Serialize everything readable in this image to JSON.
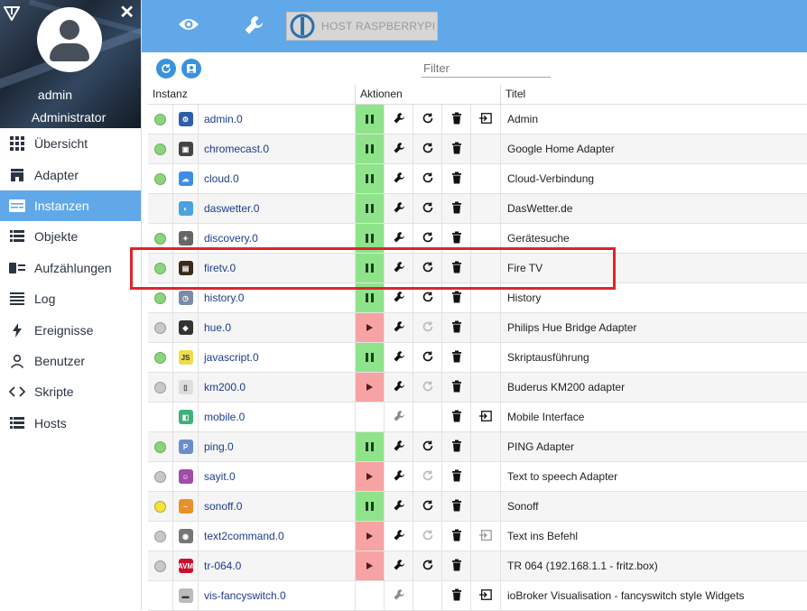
{
  "sidebar": {
    "user_name": "admin",
    "user_role": "Administrator",
    "items": [
      {
        "label": "Übersicht",
        "icon": "grid-icon",
        "active": false
      },
      {
        "label": "Adapter",
        "icon": "store-icon",
        "active": false
      },
      {
        "label": "Instanzen",
        "icon": "instances-icon",
        "active": true
      },
      {
        "label": "Objekte",
        "icon": "list-icon",
        "active": false
      },
      {
        "label": "Aufzählungen",
        "icon": "enum-icon",
        "active": false
      },
      {
        "label": "Log",
        "icon": "log-icon",
        "active": false
      },
      {
        "label": "Ereignisse",
        "icon": "lightning-icon",
        "active": false
      },
      {
        "label": "Benutzer",
        "icon": "user-icon",
        "active": false
      },
      {
        "label": "Skripte",
        "icon": "code-icon",
        "active": false
      },
      {
        "label": "Hosts",
        "icon": "hosts-icon",
        "active": false
      }
    ]
  },
  "topbar": {
    "host_label": "HOST RASPBERRYPI"
  },
  "toolbar": {
    "filter_placeholder": "Filter"
  },
  "table": {
    "headers": {
      "instance": "Instanz",
      "actions": "Aktionen",
      "title": "Titel"
    },
    "rows": [
      {
        "name": "admin.0",
        "title": "Admin",
        "status": "green",
        "run": "pause",
        "restart": true,
        "delete": true,
        "open": true,
        "icon_color": "#2d5ea8",
        "icon_text": "⚙"
      },
      {
        "name": "chromecast.0",
        "title": "Google Home Adapter",
        "status": "green",
        "run": "pause",
        "restart": true,
        "delete": true,
        "open": false,
        "icon_color": "#444444",
        "icon_text": "▣"
      },
      {
        "name": "cloud.0",
        "title": "Cloud-Verbindung",
        "status": "green",
        "run": "pause",
        "restart": true,
        "delete": true,
        "open": false,
        "icon_color": "#3d8ee6",
        "icon_text": "☁"
      },
      {
        "name": "daswetter.0",
        "title": "DasWetter.de",
        "status": "none",
        "run": "pause",
        "restart": true,
        "delete": true,
        "open": false,
        "icon_color": "#4aa3df",
        "icon_text": "◐"
      },
      {
        "name": "discovery.0",
        "title": "Gerätesuche",
        "status": "green",
        "run": "pause",
        "restart": true,
        "delete": true,
        "open": false,
        "icon_color": "#666666",
        "icon_text": "✦"
      },
      {
        "name": "firetv.0",
        "title": "Fire TV",
        "status": "green",
        "run": "pause",
        "restart": true,
        "delete": true,
        "open": false,
        "icon_color": "#3b2a1a",
        "icon_text": "▤"
      },
      {
        "name": "history.0",
        "title": "History",
        "status": "green",
        "run": "pause",
        "restart": true,
        "delete": true,
        "open": false,
        "icon_color": "#7a8aa8",
        "icon_text": "◷"
      },
      {
        "name": "hue.0",
        "title": "Philips Hue Bridge Adapter",
        "status": "grey",
        "run": "play",
        "restart": false,
        "delete": true,
        "open": false,
        "icon_color": "#333333",
        "icon_text": "◆"
      },
      {
        "name": "javascript.0",
        "title": "Skriptausführung",
        "status": "green",
        "run": "pause",
        "restart": true,
        "delete": true,
        "open": false,
        "icon_color": "#f0db4f",
        "icon_text": "JS"
      },
      {
        "name": "km200.0",
        "title": "Buderus KM200 adapter",
        "status": "grey",
        "run": "play",
        "restart": false,
        "delete": true,
        "open": false,
        "icon_color": "#dddddd",
        "icon_text": "▯"
      },
      {
        "name": "mobile.0",
        "title": "Mobile Interface",
        "status": "none",
        "run": "none",
        "restart": null,
        "delete": true,
        "open": true,
        "icon_color": "#3fb07a",
        "icon_text": "◧"
      },
      {
        "name": "ping.0",
        "title": "PING Adapter",
        "status": "green",
        "run": "pause",
        "restart": true,
        "delete": true,
        "open": false,
        "icon_color": "#6a8ec9",
        "icon_text": "P"
      },
      {
        "name": "sayit.0",
        "title": "Text to speech Adapter",
        "status": "grey",
        "run": "play",
        "restart": false,
        "delete": true,
        "open": false,
        "icon_color": "#a04ca8",
        "icon_text": "☺"
      },
      {
        "name": "sonoff.0",
        "title": "Sonoff",
        "status": "yellow",
        "run": "pause",
        "restart": true,
        "delete": true,
        "open": false,
        "icon_color": "#e8902a",
        "icon_text": "~"
      },
      {
        "name": "text2command.0",
        "title": "Text ins Befehl",
        "status": "grey",
        "run": "play",
        "restart": false,
        "delete": true,
        "open": true,
        "icon_color": "#777777",
        "icon_text": "◉"
      },
      {
        "name": "tr-064.0",
        "title": "TR 064 (192.168.1.1 - fritz.box)",
        "status": "grey",
        "run": "play",
        "restart": true,
        "delete": true,
        "open": false,
        "icon_color": "#c8102e",
        "icon_text": "AVM"
      },
      {
        "name": "vis-fancyswitch.0",
        "title": "ioBroker Visualisation - fancyswitch style Widgets",
        "status": "none",
        "run": "none",
        "restart": null,
        "delete": true,
        "open": true,
        "icon_color": "#bbbbbb",
        "icon_text": "▬"
      }
    ]
  },
  "highlighted_row": "firetv.0"
}
